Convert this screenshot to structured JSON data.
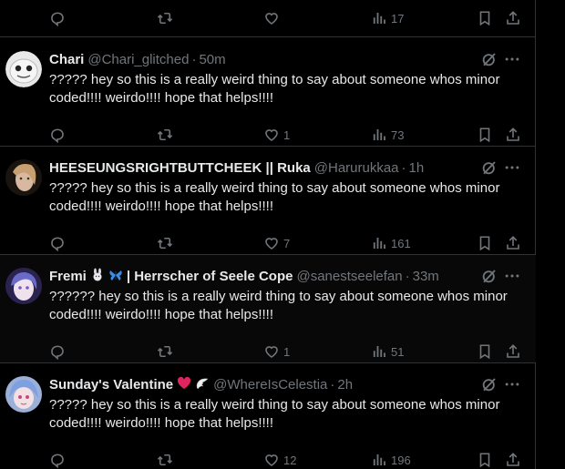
{
  "previous_tweet": {
    "views": "17"
  },
  "tweets": [
    {
      "name": "Chari",
      "handle": "@Chari_glitched",
      "time": "50m",
      "text": "????? hey so this is a really weird thing to say about someone whos minor coded!!!! weirdo!!!! hope that helps!!!!",
      "replies": "",
      "retweets": "",
      "likes": "1",
      "views": "73"
    },
    {
      "name": "HEESEUNGSRIGHTBUTTCHEEK || Ruka",
      "handle": "@Harurukkaa",
      "time": "1h",
      "text": "????? hey so this is a really weird thing to say about someone whos minor coded!!!! weirdo!!!! hope that helps!!!!",
      "replies": "",
      "retweets": "",
      "likes": "7",
      "views": "161"
    },
    {
      "name": "Fremi",
      "name_suffix": "| Herrscher of Seele Cope",
      "handle": "@sanestseelefan",
      "time": "33m",
      "text": "?????? hey so this is a really weird thing to say about someone whos minor coded!!!! weirdo!!!! hope that helps!!!!",
      "replies": "",
      "retweets": "",
      "likes": "1",
      "views": "51"
    },
    {
      "name": "Sunday's Valentine",
      "handle": "@WhereIsCelestia",
      "time": "2h",
      "text": "????? hey so this is a really weird thing to say about someone whos minor coded!!!! weirdo!!!! hope that helps!!!!",
      "replies": "",
      "retweets": "",
      "likes": "12",
      "views": "196"
    }
  ],
  "separator": "·",
  "icons": [
    "reply-icon",
    "retweet-icon",
    "like-icon",
    "views-icon",
    "bookmark-icon",
    "share-icon",
    "grok-icon",
    "more-icon"
  ],
  "colors": {
    "background": "#000000",
    "text": "#e7e9ea",
    "muted": "#71767b",
    "border": "#2f3336",
    "heart": "#e0245e"
  }
}
